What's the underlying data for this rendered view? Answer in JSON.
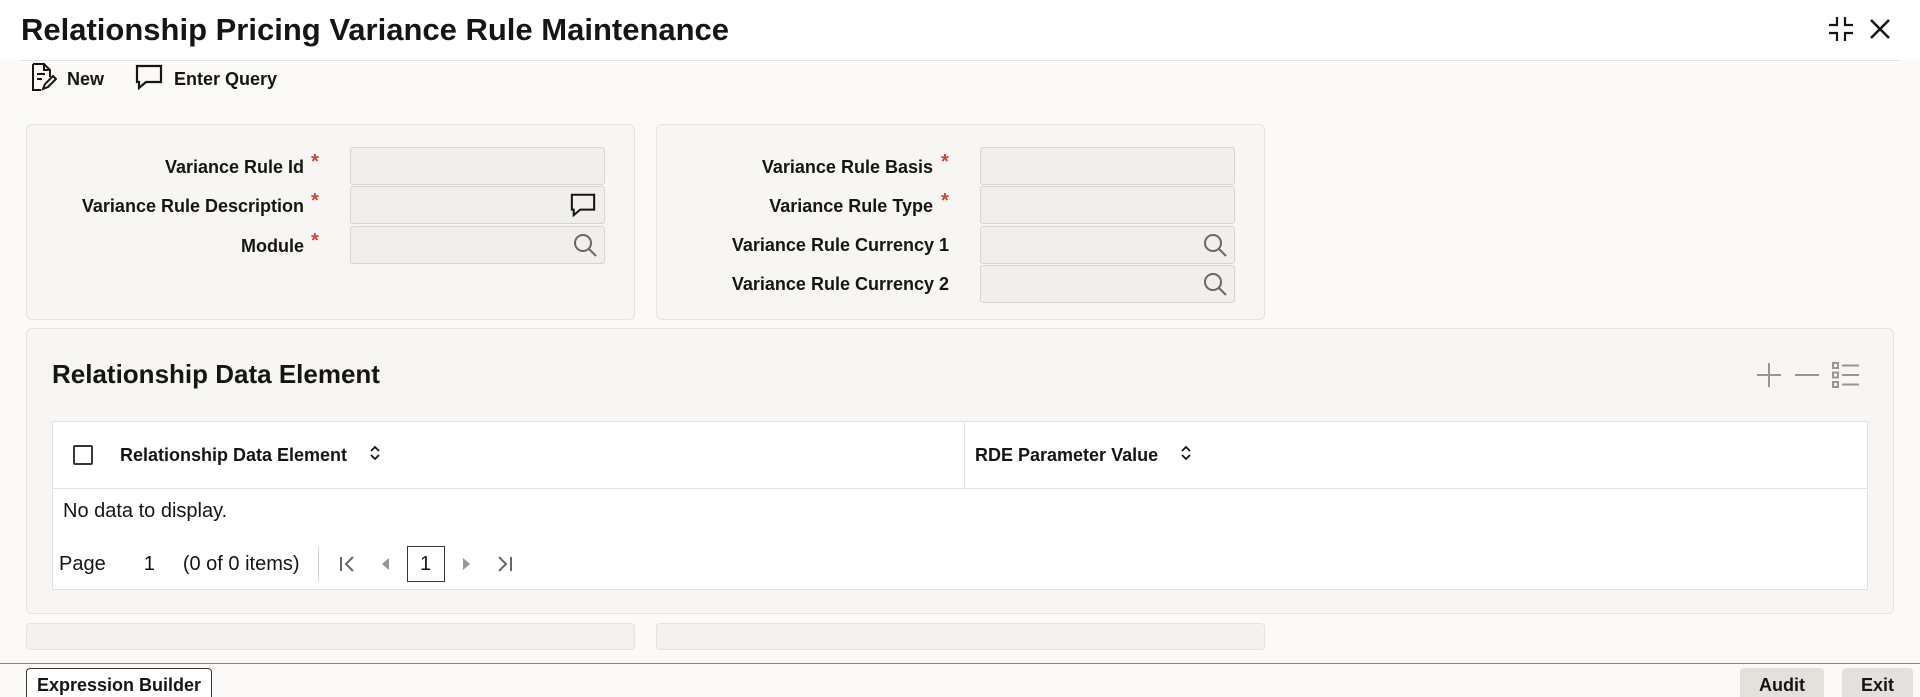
{
  "window": {
    "title": "Relationship Pricing Variance Rule Maintenance",
    "maximize_icon": "minimize-corners-icon",
    "close_icon": "close-icon"
  },
  "toolbar": {
    "new_label": "New",
    "enter_query_label": "Enter Query"
  },
  "form_left": {
    "variance_rule_id": {
      "label": "Variance Rule Id",
      "required": "*",
      "value": ""
    },
    "variance_rule_description": {
      "label": "Variance Rule Description",
      "required": "*",
      "value": ""
    },
    "module": {
      "label": "Module",
      "required": "*",
      "value": ""
    }
  },
  "form_right": {
    "variance_rule_basis": {
      "label": "Variance Rule Basis",
      "required": "*",
      "value": ""
    },
    "variance_rule_type": {
      "label": "Variance Rule Type",
      "required": "*",
      "value": ""
    },
    "variance_rule_currency_1": {
      "label": "Variance Rule Currency 1",
      "value": ""
    },
    "variance_rule_currency_2": {
      "label": "Variance Rule Currency 2",
      "value": ""
    }
  },
  "grid": {
    "title": "Relationship Data Element",
    "columns": [
      "Relationship Data Element",
      "RDE Parameter Value"
    ],
    "empty_message": "No data to display.",
    "pager": {
      "page_label": "Page",
      "page_number": "1",
      "items_summary": "(0 of 0 items)",
      "current_page": "1"
    }
  },
  "footer": {
    "expression_builder_label": "Expression Builder",
    "audit_label": "Audit",
    "exit_label": "Exit"
  },
  "colors": {
    "required": "#c74634",
    "panel_bg": "#f7f6f4",
    "input_bg": "#f1efed",
    "text": "#161513"
  }
}
